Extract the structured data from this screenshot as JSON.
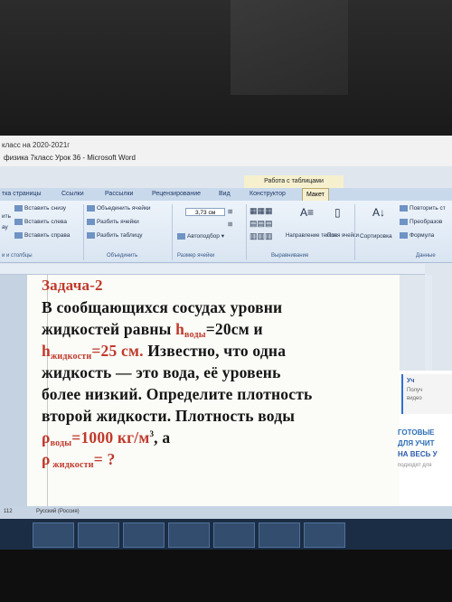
{
  "window": {
    "prev_title": "класс на 2020-2021г",
    "doc_title": "физика 7класс Урок 36 - Microsoft Word",
    "context_tab": "Работа с таблицами"
  },
  "tabs": [
    {
      "label": "тка страницы"
    },
    {
      "label": "Ссылки"
    },
    {
      "label": "Рассылки"
    },
    {
      "label": "Рецензирование"
    },
    {
      "label": "Вид"
    },
    {
      "label": "Конструктор"
    },
    {
      "label": "Макет"
    }
  ],
  "ribbon": {
    "insert_below": "Вставить снизу",
    "insert_left": "Вставить слева",
    "insert_right": "Вставить справа",
    "merge_cells": "Объединить ячейки",
    "split_cells": "Разбить ячейки",
    "split_table": "Разбить таблицу",
    "cell_size_value": "3,73 см",
    "autofit": "Автоподбор",
    "text_direction": "Направление текста",
    "cell_margins": "Поля ячейки",
    "sort": "Сортировка",
    "repeat_header": "Повторить ст",
    "convert": "Преобразов",
    "formula": "Формула",
    "groups": {
      "rows_cols": "и и столбцы",
      "merge": "Объединить",
      "cell_size": "Размер ячейки",
      "alignment": "Выравнивание",
      "data": "Данные"
    },
    "small_labels": {
      "delete": "ить",
      "ay": "ау"
    }
  },
  "document": {
    "heading": "Задача-2",
    "line1": "В сообщающихся сосудах уровни",
    "line2_pre": "жидкостей равны ",
    "h_symbol": "h",
    "sub_water": "воды",
    "eq_20": "=20см и",
    "sub_liquid": "жидкости",
    "eq_25": "=25 см.",
    "line3_post": " Известно, что одна",
    "line4": "жидкость — это вода, её уровень",
    "line5": "более низкий. Определите плотность",
    "line6": "второй жидкости. Плотность воды",
    "rho": "ρ",
    "rho_water_val": "=1000 кг/м",
    "cube": "3",
    "line7_tail": ", а",
    "rho_liquid_label": " жидкости",
    "rho_liquid_q": "= ?"
  },
  "ad": {
    "card_line1": "Уч",
    "card_line2": "Получ",
    "card_line3": "видео",
    "headline1": "ГОТОВЫЕ",
    "headline2": "ДЛЯ УЧИТ",
    "headline3": "НА ВЕСЬ У",
    "small": "подходят для"
  },
  "status": {
    "lang": "Русский (Россия)",
    "left": "112"
  }
}
